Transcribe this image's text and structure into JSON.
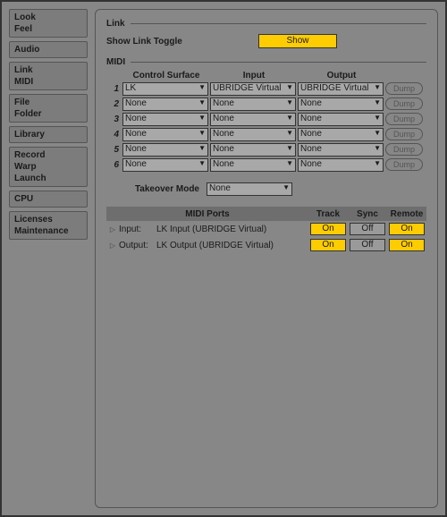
{
  "sidebar": [
    {
      "items": [
        "Look",
        "Feel"
      ]
    },
    {
      "items": [
        "Audio"
      ]
    },
    {
      "items": [
        "Link",
        "MIDI"
      ]
    },
    {
      "items": [
        "File",
        "Folder"
      ]
    },
    {
      "items": [
        "Library"
      ]
    },
    {
      "items": [
        "Record",
        "Warp",
        "Launch"
      ]
    },
    {
      "items": [
        "CPU"
      ]
    },
    {
      "items": [
        "Licenses",
        "Maintenance"
      ]
    }
  ],
  "section": {
    "link": "Link",
    "midi": "MIDI"
  },
  "show_link": {
    "label": "Show Link Toggle",
    "button": "Show"
  },
  "midi": {
    "headers": {
      "num": "",
      "cs": "Control Surface",
      "in": "Input",
      "out": "Output"
    },
    "rows": [
      {
        "n": "1",
        "cs": "LK",
        "in": "UBRIDGE Virtual",
        "out": "UBRIDGE Virtual"
      },
      {
        "n": "2",
        "cs": "None",
        "in": "None",
        "out": "None"
      },
      {
        "n": "3",
        "cs": "None",
        "in": "None",
        "out": "None"
      },
      {
        "n": "4",
        "cs": "None",
        "in": "None",
        "out": "None"
      },
      {
        "n": "5",
        "cs": "None",
        "in": "None",
        "out": "None"
      },
      {
        "n": "6",
        "cs": "None",
        "in": "None",
        "out": "None"
      }
    ],
    "dump": "Dump"
  },
  "takeover": {
    "label": "Takeover Mode",
    "value": "None"
  },
  "ports": {
    "headers": {
      "title": "MIDI Ports",
      "track": "Track",
      "sync": "Sync",
      "remote": "Remote"
    },
    "rows": [
      {
        "dir": "Input:",
        "name": "LK Input (UBRIDGE Virtual)",
        "track": "On",
        "sync": "Off",
        "remote": "On"
      },
      {
        "dir": "Output:",
        "name": "LK Output (UBRIDGE Virtual)",
        "track": "On",
        "sync": "Off",
        "remote": "On"
      }
    ]
  }
}
